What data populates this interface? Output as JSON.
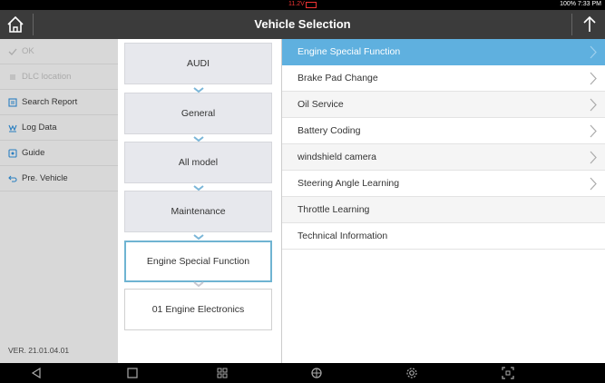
{
  "status_bar": {
    "voltage": "11.2V",
    "right_text": "100% 7:33 PM"
  },
  "title_bar": {
    "title": "Vehicle Selection"
  },
  "left_panel": {
    "items": [
      {
        "label": "OK",
        "icon": "check-icon",
        "enabled": false
      },
      {
        "label": "DLC location",
        "icon": "dlc-icon",
        "enabled": false
      },
      {
        "label": "Search Report",
        "icon": "report-icon",
        "enabled": true
      },
      {
        "label": "Log Data",
        "icon": "log-icon",
        "enabled": true
      },
      {
        "label": "Guide",
        "icon": "guide-icon",
        "enabled": true
      },
      {
        "label": "Pre. Vehicle",
        "icon": "back-arrow-icon",
        "enabled": true
      }
    ],
    "version": "VER. 21.01.04.01"
  },
  "breadcrumb": {
    "steps": [
      {
        "label": "AUDI",
        "state": "done"
      },
      {
        "label": "General",
        "state": "done"
      },
      {
        "label": "All model",
        "state": "done"
      },
      {
        "label": "Maintenance",
        "state": "done"
      },
      {
        "label": "Engine Special Function",
        "state": "active"
      },
      {
        "label": "01 Engine Electronics",
        "state": "future"
      }
    ]
  },
  "function_list": {
    "items": [
      {
        "label": "Engine Special Function",
        "selected": true,
        "has_submenu": true
      },
      {
        "label": "Brake Pad Change",
        "selected": false,
        "has_submenu": true
      },
      {
        "label": "Oil Service",
        "selected": false,
        "has_submenu": true
      },
      {
        "label": "Battery Coding",
        "selected": false,
        "has_submenu": true
      },
      {
        "label": "windshield camera",
        "selected": false,
        "has_submenu": true
      },
      {
        "label": "Steering Angle Learning",
        "selected": false,
        "has_submenu": true
      },
      {
        "label": "Throttle Learning",
        "selected": false,
        "has_submenu": false
      },
      {
        "label": "Technical Information",
        "selected": false,
        "has_submenu": false
      }
    ]
  },
  "nav_bar": {
    "icons": [
      "back-icon",
      "recent-apps-icon",
      "apps-grid-icon",
      "browser-icon",
      "settings-icon",
      "screenshot-icon"
    ]
  },
  "colors": {
    "accent": "#5fb0df",
    "title_bar": "#3b3b3b",
    "left_panel": "#d8d8d8",
    "breadcrumb_active_border": "#6fb4d2",
    "voltage": "#e33333"
  }
}
